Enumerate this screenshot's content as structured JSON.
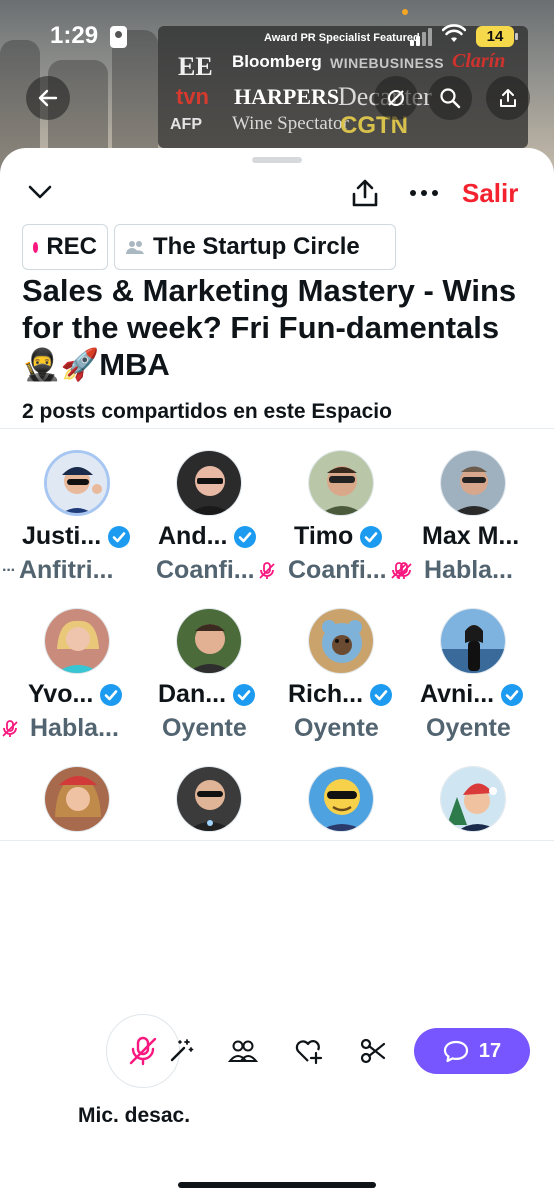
{
  "status_bar": {
    "time": "1:29",
    "notification": "Award PR Specialist Featured",
    "battery": "14"
  },
  "banner": {
    "brands": [
      "EE",
      "Bloomberg",
      "WINEBUSINESS",
      "Clarín",
      "tvn",
      "HARPERS",
      "Decanter",
      "AFP",
      "Wine Spectator",
      "CGTN"
    ]
  },
  "header": {
    "exit_label": "Salir"
  },
  "space": {
    "rec_label": "REC",
    "community": "The Startup Circle",
    "title": "Sales & Marketing Mastery - Wins for the week? Fri Fun-damentals 🥷🚀MBA",
    "subtitle": "2 posts compartidos en este Espacio"
  },
  "participants": [
    {
      "name": "Justi...",
      "role": "Anfitri...",
      "verified": true,
      "muted": false
    },
    {
      "name": "And...",
      "role": "Coanfi...",
      "verified": true,
      "muted": true
    },
    {
      "name": "Timo",
      "role": "Coanfi...",
      "verified": true,
      "muted": true
    },
    {
      "name": "Max M...",
      "role": "Habla...",
      "verified": false,
      "muted": true
    },
    {
      "name": "Yvo...",
      "role": "Habla...",
      "verified": true,
      "muted": true
    },
    {
      "name": "Dan...",
      "role": "Oyente",
      "verified": true,
      "muted": false
    },
    {
      "name": "Rich...",
      "role": "Oyente",
      "verified": true,
      "muted": false
    },
    {
      "name": "Avni...",
      "role": "Oyente",
      "verified": true,
      "muted": false
    },
    {
      "name": "",
      "role": "",
      "verified": false,
      "muted": false
    },
    {
      "name": "",
      "role": "",
      "verified": false,
      "muted": false
    },
    {
      "name": "",
      "role": "",
      "verified": false,
      "muted": false
    },
    {
      "name": "",
      "role": "",
      "verified": false,
      "muted": false
    }
  ],
  "bottom_bar": {
    "mic_label": "Mic. desac.",
    "chat_count": "17",
    "accent_color": "#7856ff",
    "mute_color": "#f91880"
  },
  "colors": {
    "exit": "#f4212e",
    "verified": "#1d9bf0",
    "rec_dot": "#f91880"
  }
}
